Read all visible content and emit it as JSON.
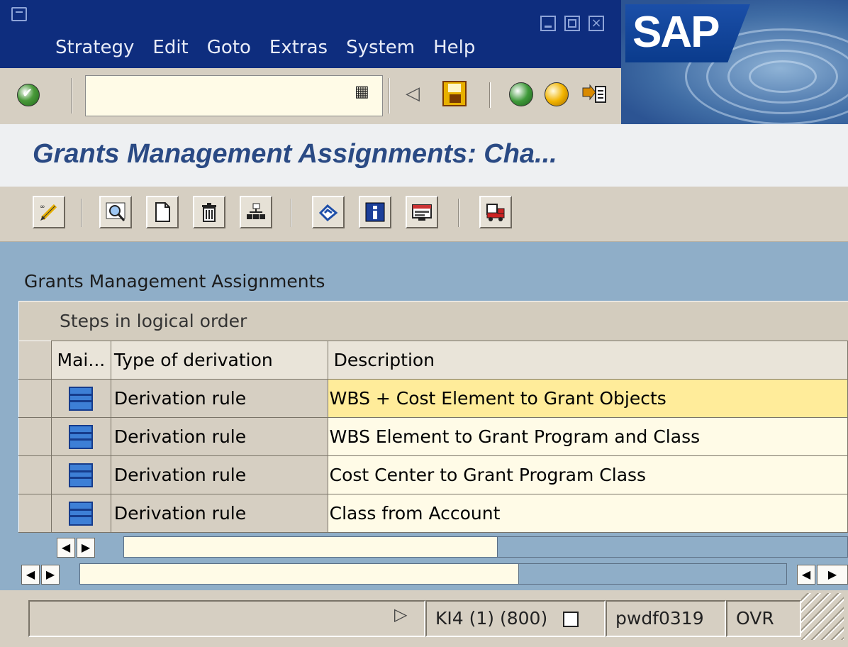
{
  "menu": [
    "Strategy",
    "Edit",
    "Goto",
    "Extras",
    "System",
    "Help"
  ],
  "logo": "SAP",
  "title": "Grants Management Assignments: Cha...",
  "section_label": "Grants Management Assignments",
  "steps_title": "Steps in logical order",
  "table": {
    "columns": [
      "Mai...",
      "Type of derivation",
      "Description"
    ],
    "rows": [
      {
        "type": "Derivation rule",
        "description": "WBS + Cost Element to Grant Objects"
      },
      {
        "type": "Derivation rule",
        "description": "WBS Element to Grant Program and Class"
      },
      {
        "type": "Derivation rule",
        "description": "Cost Center to Grant Program Class"
      },
      {
        "type": "Derivation rule",
        "description": "Class from Account"
      }
    ]
  },
  "status": {
    "system": "KI4 (1) (800)",
    "server": "pwdf0319",
    "mode": "OVR"
  },
  "colors": {
    "menu_bar": "#0e2d7e",
    "title_text": "#2a4a84",
    "work_area": "#8faec8",
    "active_row": "#ffec9a"
  }
}
